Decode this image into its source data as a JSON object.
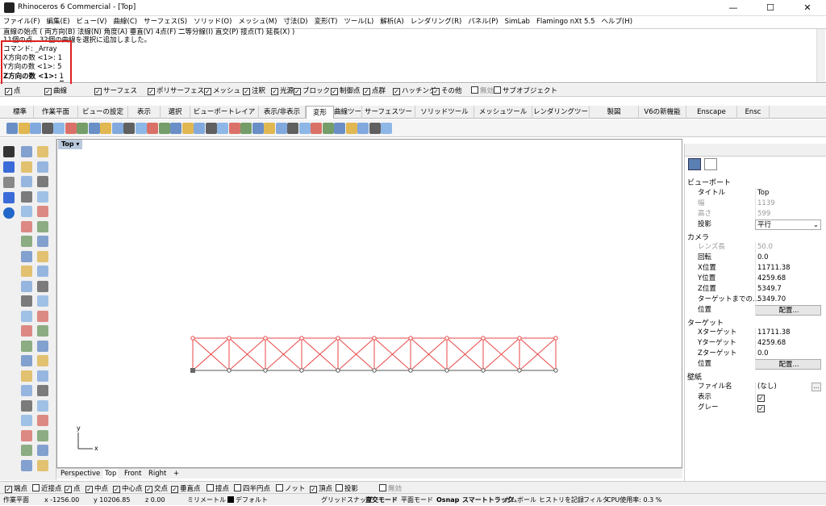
{
  "window": {
    "title": "Rhinoceros 6 Commercial - [Top]",
    "minimize": "—",
    "maximize": "☐",
    "close": "✕"
  },
  "menu": [
    "ファイル(F)",
    "編集(E)",
    "ビュー(V)",
    "曲線(C)",
    "サーフェス(S)",
    "ソリッド(O)",
    "メッシュ(M)",
    "寸法(D)",
    "変形(T)",
    "ツール(L)",
    "解析(A)",
    "レンダリング(R)",
    "パネル(P)",
    "SimLab",
    "Flamingo nXt 5.5",
    "ヘルプ(H)"
  ],
  "command_history": [
    "直線の始点 ( 両方向(B)  法線(N)  角度(A)  垂直(V)  4点(F)  二等分線(I)  直交(P)  接点(T)  延長(X) )",
    "11個の点、32個の曲線を選択に追加しました。",
    "コマンド: _Array",
    "X方向の数 <1>: 1",
    "Y方向の数 <1>: 5"
  ],
  "command_prompt": {
    "label": "Z方向の数 <1>:",
    "value": "1"
  },
  "filter_checks": [
    {
      "label": "点",
      "checked": true
    },
    {
      "label": "曲線",
      "checked": true
    },
    {
      "label": "サーフェス",
      "checked": true
    },
    {
      "label": "ポリサーフェス",
      "checked": true
    },
    {
      "label": "メッシュ",
      "checked": true
    },
    {
      "label": "注釈",
      "checked": true
    },
    {
      "label": "光源",
      "checked": true
    },
    {
      "label": "ブロック",
      "checked": true
    },
    {
      "label": "制御点",
      "checked": true
    },
    {
      "label": "点群",
      "checked": true
    },
    {
      "label": "ハッチング",
      "checked": true
    },
    {
      "label": "その他",
      "checked": true
    },
    {
      "label": "無効",
      "checked": false
    },
    {
      "label": "サブオブジェクト",
      "checked": false
    }
  ],
  "tabs": [
    "標準",
    "作業平面",
    "ビューの設定",
    "表示",
    "選択",
    "ビューポートレイアウト",
    "表示/非表示",
    "変形",
    "曲線ツール",
    "サーフェスツール",
    "ソリッドツール",
    "メッシュツール",
    "レンダリングツール",
    "製図",
    "V6の新機能",
    "Enscape",
    "Ensc"
  ],
  "active_tab": "変形",
  "viewport": {
    "label": "Top",
    "axis_x": "x",
    "axis_y": "y"
  },
  "view_tabs": [
    "Perspective",
    "Top",
    "Front",
    "Right",
    "+"
  ],
  "properties": {
    "section_viewport": "ビューポート",
    "title_k": "タイトル",
    "title_v": "Top",
    "width_k": "幅",
    "width_v": "1139",
    "height_k": "高さ",
    "height_v": "599",
    "proj_k": "投影",
    "proj_v": "平行",
    "section_camera": "カメラ",
    "lens_k": "レンズ長",
    "lens_v": "50.0",
    "rot_k": "回転",
    "rot_v": "0.0",
    "xpos_k": "X位置",
    "xpos_v": "11711.38",
    "ypos_k": "Y位置",
    "ypos_v": "4259.68",
    "zpos_k": "Z位置",
    "zpos_v": "5349.7",
    "tdist_k": "ターゲットまでの...",
    "tdist_v": "5349.70",
    "pos_k": "位置",
    "place_btn": "配置...",
    "section_target": "ターゲット",
    "xt_k": "Xターゲット",
    "xt_v": "11711.38",
    "yt_k": "Yターゲット",
    "yt_v": "4259.68",
    "zt_k": "Zターゲット",
    "zt_v": "0.0",
    "tpos_k": "位置",
    "tplace_btn": "配置...",
    "section_wall": "壁紙",
    "file_k": "ファイル名",
    "file_v": "(なし)",
    "show_k": "表示",
    "grey_k": "グレー"
  },
  "osnap": [
    {
      "label": "端点",
      "checked": true
    },
    {
      "label": "近接点",
      "checked": false
    },
    {
      "label": "点",
      "checked": true
    },
    {
      "label": "中点",
      "checked": true
    },
    {
      "label": "中心点",
      "checked": true
    },
    {
      "label": "交点",
      "checked": true
    },
    {
      "label": "垂直点",
      "checked": true
    },
    {
      "label": "接点",
      "checked": false
    },
    {
      "label": "四半円点",
      "checked": false
    },
    {
      "label": "ノット",
      "checked": false
    },
    {
      "label": "頂点",
      "checked": true
    },
    {
      "label": "投影",
      "checked": false
    },
    {
      "label": "無効",
      "checked": false
    }
  ],
  "status": {
    "cplane": "作業平面",
    "x": "x -1256.00",
    "y": "y 10206.85",
    "z": "z 0.00",
    "unit": "ミリメートル",
    "layer": "デフォルト",
    "grid": "グリッドスナップ",
    "ortho": "直交モード",
    "planar": "平面モード",
    "osnap": "Osnap",
    "smarttrack": "スマートトラック",
    "gumball": "ガムボール",
    "history": "ヒストリを記録",
    "filter": "フィルタ",
    "cpu": "CPU使用率: 0.3 %"
  },
  "colors": {
    "accent_red": "#e0201e",
    "geometry": "#e84646"
  }
}
